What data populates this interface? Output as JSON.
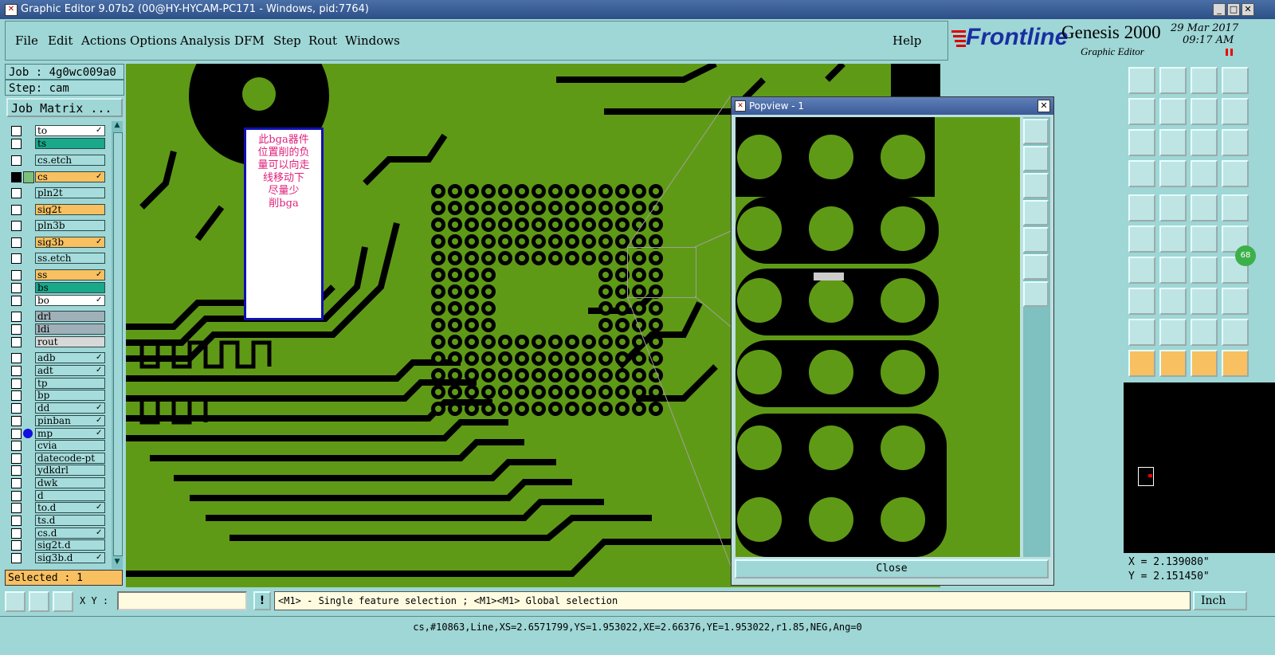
{
  "window": {
    "title": "Graphic Editor 9.07b2 (00@HY-HYCAM-PC171 - Windows, pid:7764)",
    "controls": {
      "minimize": "_",
      "maximize": "□",
      "close": "✕"
    }
  },
  "menu": [
    "File",
    "Edit",
    "Actions",
    "Options",
    "Analysis",
    "DFM",
    "Step",
    "Rout",
    "Windows"
  ],
  "help_label": "Help",
  "brand": {
    "logo": "Frontline",
    "product": "Genesis 2000",
    "subtitle": "Graphic Editor",
    "date": "29 Mar 2017",
    "time": "09:17 AM"
  },
  "job": {
    "label": "Job : 4g0wc009a0",
    "step": "Step: cam",
    "matrix_button": "Job Matrix ..."
  },
  "layers": [
    {
      "name": "to",
      "color": "#ffffff",
      "mark": "✓"
    },
    {
      "name": "ts",
      "color": "#1aa88a",
      "mark": ""
    },
    {
      "name": "cs.etch",
      "color": "#a6dcdc",
      "mark": ""
    },
    {
      "name": "cs",
      "color": "#f8c060",
      "mark": "✓",
      "active": true
    },
    {
      "name": "pln2t",
      "color": "#a6dcdc",
      "mark": ""
    },
    {
      "name": "sig2t",
      "color": "#f8c060",
      "mark": ""
    },
    {
      "name": "pln3b",
      "color": "#a6dcdc",
      "mark": ""
    },
    {
      "name": "sig3b",
      "color": "#f8c060",
      "mark": "✓"
    },
    {
      "name": "ss.etch",
      "color": "#a6dcdc",
      "mark": ""
    },
    {
      "name": "ss",
      "color": "#f8c060",
      "mark": "✓"
    },
    {
      "name": "bs",
      "color": "#1aa88a",
      "mark": ""
    },
    {
      "name": "bo",
      "color": "#ffffff",
      "mark": "✓"
    },
    {
      "name": "drl",
      "color": "#a0b0b8",
      "mark": ""
    },
    {
      "name": "ldi",
      "color": "#a0b0b8",
      "mark": ""
    },
    {
      "name": "rout",
      "color": "#d8d8d8",
      "mark": ""
    },
    {
      "name": "adb",
      "color": "#a6dcdc",
      "mark": "✓"
    },
    {
      "name": "adt",
      "color": "#a6dcdc",
      "mark": "✓"
    },
    {
      "name": "tp",
      "color": "#a6dcdc",
      "mark": ""
    },
    {
      "name": "bp",
      "color": "#a6dcdc",
      "mark": ""
    },
    {
      "name": "dd",
      "color": "#a6dcdc",
      "mark": "✓"
    },
    {
      "name": "pinban",
      "color": "#a6dcdc",
      "mark": "✓"
    },
    {
      "name": "mp",
      "color": "#a6dcdc",
      "mark": "✓",
      "dot": "#1010e0"
    },
    {
      "name": "cvia",
      "color": "#a6dcdc",
      "mark": ""
    },
    {
      "name": "datecode-pt",
      "color": "#a6dcdc",
      "mark": ""
    },
    {
      "name": "ydkdrl",
      "color": "#a6dcdc",
      "mark": ""
    },
    {
      "name": "dwk",
      "color": "#a6dcdc",
      "mark": ""
    },
    {
      "name": "d",
      "color": "#a6dcdc",
      "mark": ""
    },
    {
      "name": "to.d",
      "color": "#a6dcdc",
      "mark": "✓"
    },
    {
      "name": "ts.d",
      "color": "#a6dcdc",
      "mark": ""
    },
    {
      "name": "cs.d",
      "color": "#a6dcdc",
      "mark": "✓"
    },
    {
      "name": "sig2t.d",
      "color": "#a6dcdc",
      "mark": ""
    },
    {
      "name": "sig3b.d",
      "color": "#a6dcdc",
      "mark": "✓"
    }
  ],
  "selected": "Selected : 1",
  "note": {
    "lines": [
      "此bga器件",
      "位置削的负",
      "量可以向走",
      "线移动下",
      "尽量少",
      "削bga"
    ]
  },
  "popview": {
    "title": "Popview - 1",
    "close_label": "Close"
  },
  "coords": {
    "x": "X = 2.139080\"",
    "y": "Y = 2.151450\""
  },
  "badge": "68",
  "cmd": {
    "xy_label": "X Y :",
    "xy_value": "",
    "hint": "<M1> - Single feature selection ; <M1><M1> Global selection",
    "unit": "Inch"
  },
  "status": "cs,#10863,Line,XS=2.6571799,YS=1.953022,XE=2.66376,YE=1.953022,r1.85,NEG,Ang=0",
  "toolbar_icons": [
    "layer-up-icon",
    "layer-down-icon",
    "home-icon",
    "window-icon",
    "step-in-icon",
    "step-out-icon",
    "pan-icon",
    "route-icon",
    "fit-icon",
    "zoom-center-icon",
    "ratio-icon",
    "help-icon",
    "measure-icon",
    "grid-icon",
    "filter-icon",
    "snap-icon",
    "add-pad-icon",
    "add-line-icon",
    "ruler-icon",
    "pad-icon",
    "connect-icon",
    "delete-icon",
    "arrow-icon",
    "move-icon",
    "slope-icon",
    "pen-icon",
    "rotate-icon",
    "dash-icon",
    "attr-icon",
    "minus-icon",
    "box-icon",
    "copy-icon",
    "triangle-icon",
    "triangle-up-icon",
    "triangle-a-icon",
    "triangle-b-icon",
    "select-icon",
    "select-box-icon",
    "select-circle-icon",
    "select-move-icon"
  ]
}
